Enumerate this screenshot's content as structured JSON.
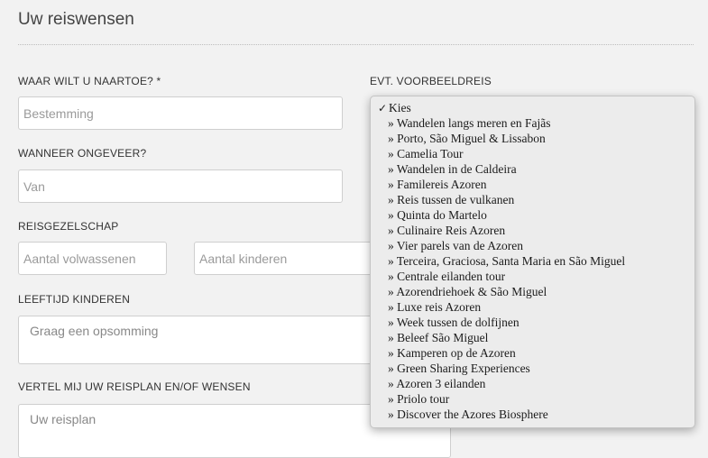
{
  "section": {
    "title": "Uw reiswensen"
  },
  "destination": {
    "label": "WAAR WILT U NAARTOE? *",
    "placeholder": "Bestemming"
  },
  "example_trip": {
    "label": "EVT. VOORBEELDREIS",
    "selected": "Kies",
    "checkmark": "✓",
    "bullet": "» ",
    "options": [
      "Wandelen langs meren en Fajãs",
      "Porto, São Miguel & Lissabon",
      "Camelia Tour",
      "Wandelen in de Caldeira",
      "Familereis Azoren",
      "Reis tussen de vulkanen",
      "Quinta do Martelo",
      "Culinaire Reis Azoren",
      "Vier parels van de Azoren",
      "Terceira, Graciosa, Santa Maria en São Miguel",
      "Centrale eilanden tour",
      "Azorendriehoek & São Miguel",
      "Luxe reis Azoren",
      "Week tussen de dolfijnen",
      "Beleef São Miguel",
      "Kamperen op de Azoren",
      "Green Sharing Experiences",
      "Azoren 3 eilanden",
      "Priolo tour",
      "Discover the Azores Biosphere"
    ]
  },
  "when": {
    "label": "WANNEER ONGEVEER?",
    "from_placeholder": "Van"
  },
  "travel_group": {
    "label": "REISGEZELSCHAP",
    "adults_placeholder": "Aantal volwassenen",
    "children_placeholder": "Aantal kinderen"
  },
  "children_age": {
    "label": "LEEFTIJD KINDEREN",
    "placeholder": "Graag een opsomming"
  },
  "plan": {
    "label": "VERTEL MIJ UW REISPLAN EN/OF WENSEN",
    "placeholder": "Uw reisplan"
  }
}
